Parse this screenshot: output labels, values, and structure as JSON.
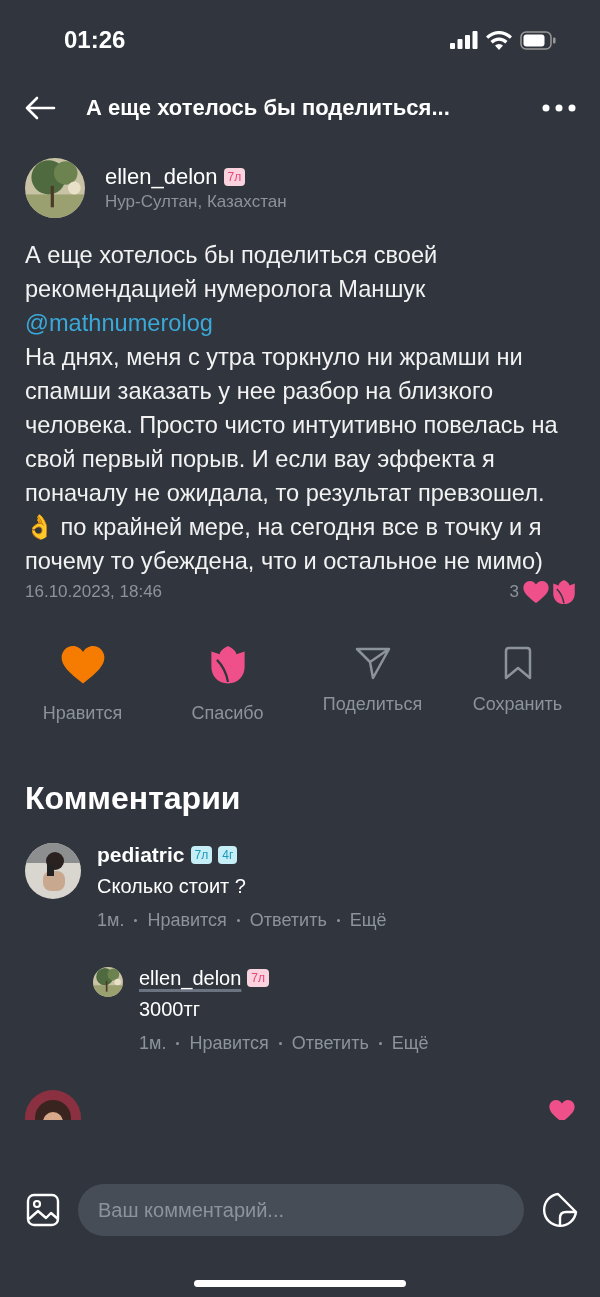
{
  "status_bar": {
    "time": "01:26"
  },
  "header": {
    "title": "А еще хотелось бы поделиться..."
  },
  "post": {
    "author": {
      "name": "ellen_delon",
      "location": "Нур-Султан, Казахстан",
      "badges": [
        {
          "text": "7л",
          "color": "#e8457a"
        }
      ]
    },
    "text_before": "А еще хотелось бы поделиться своей рекомендацией нумеролога Маншук",
    "mention": "@mathnumerolog",
    "text_after": "На днях, меня с утра торкнуло ни жрамши ни спамши заказать у нее разбор на близкого человека. Просто чисто интуитивно повелась на свой первый порыв. И если вау эффекта я поначалу не ожидала, то результат превзошел. 👌 по крайней мере, на сегодня все в точку и я почему то убеждена, что и остальное не мимо)",
    "date": "16.10.2023, 18:46",
    "reaction_count": "3"
  },
  "actions": [
    {
      "kind": "like",
      "label": "Нравится",
      "active": true
    },
    {
      "kind": "thanks",
      "label": "Спасибо",
      "active": true
    },
    {
      "kind": "share",
      "label": "Поделиться",
      "active": false
    },
    {
      "kind": "save",
      "label": "Сохранить",
      "active": false
    }
  ],
  "comments_title": "Комментарии",
  "comments": [
    {
      "author": "pediatric",
      "badges": [
        {
          "text": "7л",
          "color": "#1a9ab8"
        },
        {
          "text": "4г",
          "color": "#1a9ab8"
        }
      ],
      "text": "Сколько стоит ?",
      "time": "1м.",
      "like": "Нравится",
      "reply": "Ответить",
      "more": "Ещё",
      "children": [
        {
          "author": "ellen_delon",
          "badges": [
            {
              "text": "7л",
              "color": "#e8457a"
            }
          ],
          "text": "3000тг",
          "time": "1м.",
          "like": "Нравится",
          "reply": "Ответить",
          "more": "Ещё"
        }
      ]
    },
    {
      "kind": "peek"
    }
  ],
  "composer": {
    "placeholder": "Ваш комментарий..."
  }
}
